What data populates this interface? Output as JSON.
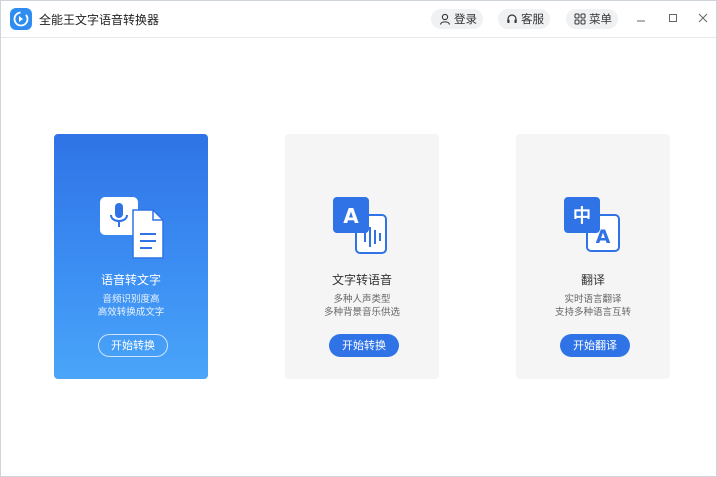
{
  "app": {
    "title": "全能王文字语音转换器"
  },
  "header": {
    "login_label": "登录",
    "service_label": "客服",
    "menu_label": "菜单"
  },
  "colors": {
    "accent": "#2f73e6",
    "card_bg": "#f5f5f6",
    "pill_bg": "#f0f1f3"
  },
  "features": [
    {
      "title": "语音转文字",
      "desc_line1": "音频识别度高",
      "desc_line2": "高效转换成文字",
      "button": "开始转换",
      "icon": "mic-document-icon",
      "selected": true
    },
    {
      "title": "文字转语音",
      "desc_line1": "多种人声类型",
      "desc_line2": "多种背景音乐供选",
      "button": "开始转换",
      "icon": "text-to-audio-icon",
      "selected": false
    },
    {
      "title": "翻译",
      "desc_line1": "实时语言翻译",
      "desc_line2": "支持多种语言互转",
      "button": "开始翻译",
      "icon": "translate-icon",
      "icon_text_a": "中",
      "icon_text_b": "A",
      "selected": false
    }
  ],
  "icons": {
    "tts_letter": "A"
  }
}
